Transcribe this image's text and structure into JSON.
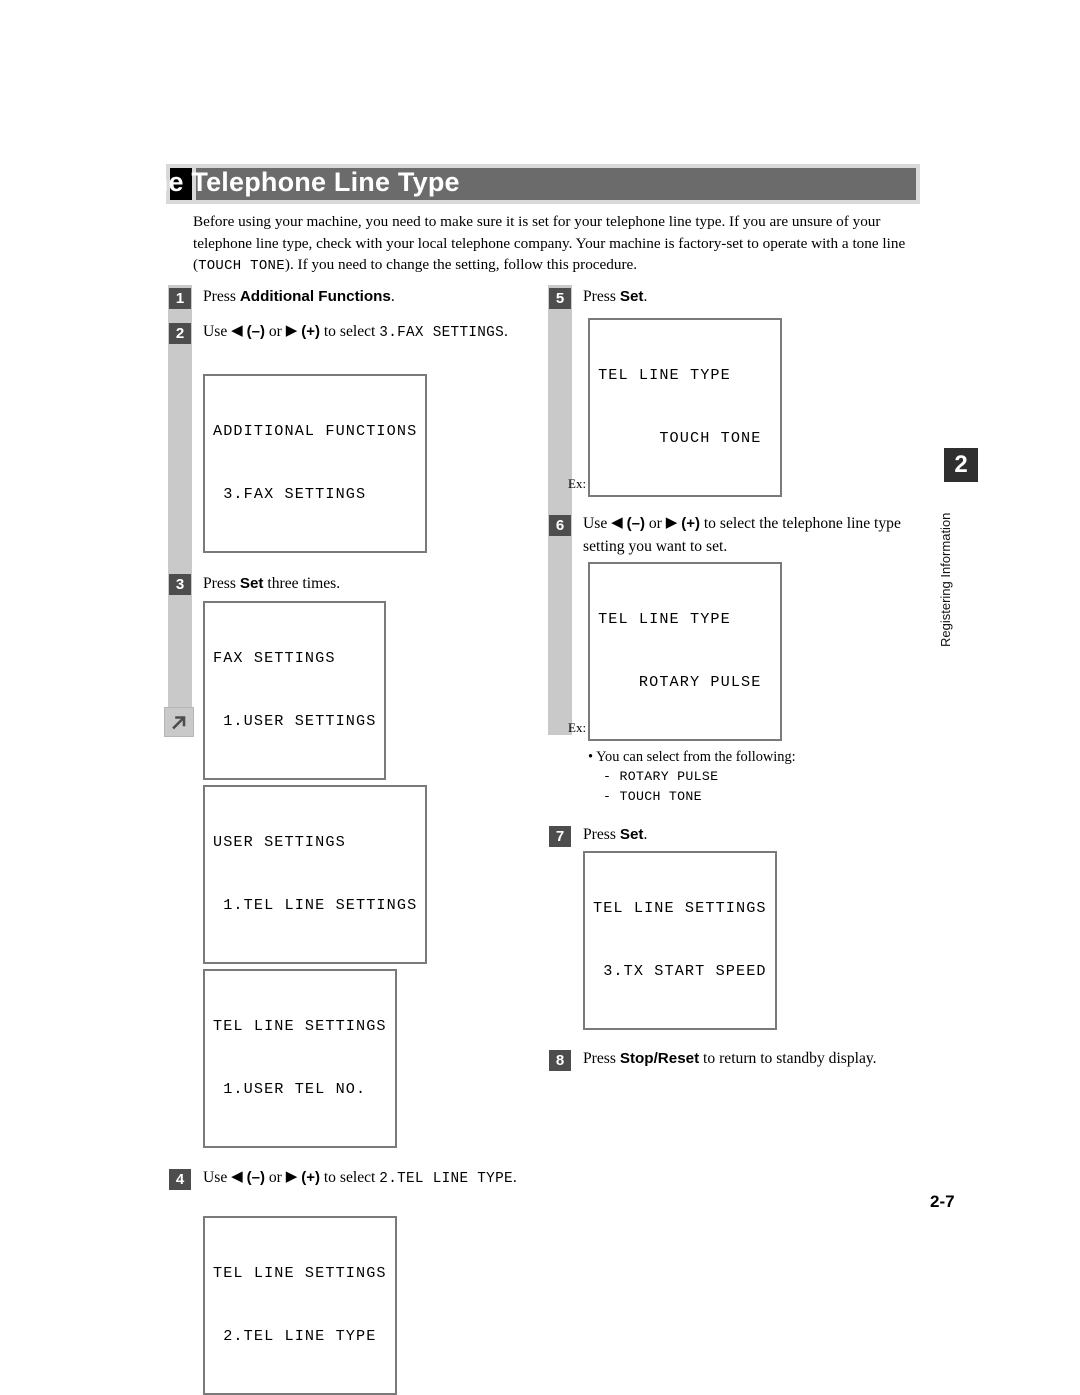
{
  "page": {
    "title": "Setting the Telephone Line Type",
    "page_number": "2-7"
  },
  "intro": {
    "part1": "Before using your machine, you need to make sure it is set for your telephone line type. If you are unsure of your telephone line type, check with your local telephone company. Your machine is factory-set to operate with a tone line (",
    "mono": "TOUCH TONE",
    "part2": "). If you need to change the setting, follow this procedure."
  },
  "side_tab": {
    "number": "2",
    "label": "Registering Information"
  },
  "icons": {
    "continuation_arrow": "arrow-up-right-icon",
    "left_triangle": "◀",
    "right_triangle": "▶",
    "minus": "(–)",
    "plus": "(+)"
  },
  "left_column": {
    "steps": [
      {
        "num": "1",
        "text_pre": "Press ",
        "bold": "Additional Functions",
        "text_post": "."
      },
      {
        "num": "2",
        "text_pre": "Use ",
        "text_mid": " or ",
        "text_after": " to select ",
        "mono_target": "3.FAX SETTINGS",
        "text_end": ".",
        "lcd": {
          "line1": "ADDITIONAL FUNCTIONS",
          "line2": " 3.FAX SETTINGS"
        }
      },
      {
        "num": "3",
        "text_pre": "Press ",
        "bold": "Set",
        "text_post": " three times.",
        "lcds": [
          {
            "line1": "FAX SETTINGS",
            "line2": " 1.USER SETTINGS"
          },
          {
            "line1": "USER SETTINGS",
            "line2": " 1.TEL LINE SETTINGS"
          },
          {
            "line1": "TEL LINE SETTINGS",
            "line2": " 1.USER TEL NO."
          }
        ]
      },
      {
        "num": "4",
        "text_pre": "Use ",
        "text_mid": " or ",
        "text_after": " to select ",
        "mono_target": "2.TEL LINE TYPE",
        "text_end": ".",
        "lcd": {
          "line1": "TEL LINE SETTINGS",
          "line2": " 2.TEL LINE TYPE"
        }
      }
    ]
  },
  "right_column": {
    "steps": [
      {
        "num": "5",
        "text_pre": "Press ",
        "bold": "Set",
        "text_post": ".",
        "ex_label": "Ex:",
        "lcd": {
          "line1": "TEL LINE TYPE",
          "line2": "      TOUCH TONE "
        }
      },
      {
        "num": "6",
        "text_pre": "Use ",
        "text_mid": " or ",
        "text_after": " to select the telephone line type setting you want to set.",
        "ex_label": "Ex:",
        "lcd": {
          "line1": "TEL LINE TYPE",
          "line2": "    ROTARY PULSE "
        },
        "note": {
          "bullet": "•  You can select from the following:",
          "items": [
            "-  ROTARY PULSE",
            "-  TOUCH TONE"
          ]
        }
      },
      {
        "num": "7",
        "text_pre": "Press ",
        "bold": "Set",
        "text_post": ".",
        "lcd": {
          "line1": "TEL LINE SETTINGS",
          "line2": " 3.TX START SPEED"
        }
      },
      {
        "num": "8",
        "text_pre": "Press ",
        "bold": "Stop/Reset",
        "text_post": " to return to standby display."
      }
    ]
  }
}
